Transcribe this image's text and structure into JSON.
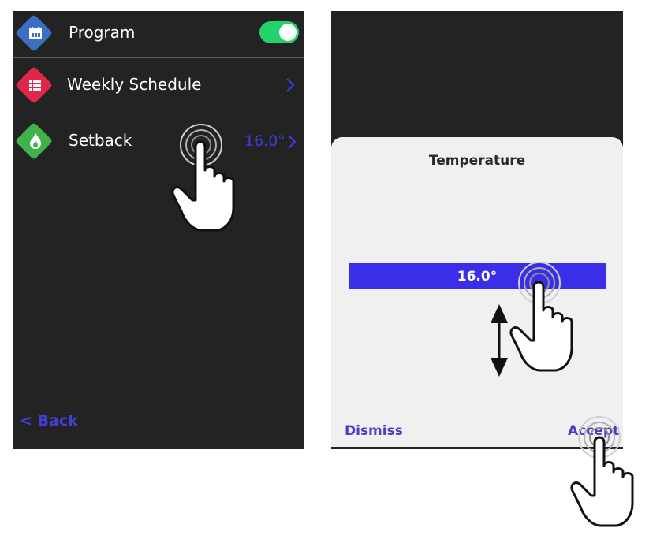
{
  "left_screen": {
    "rows": [
      {
        "label": "Program",
        "icon": "calendar-icon",
        "color": "#3a6fc2",
        "toggle": "on"
      },
      {
        "label": "Weekly Schedule",
        "icon": "list-icon",
        "color": "#e0264a"
      },
      {
        "label": "Setback",
        "icon": "flame-icon",
        "color": "#3fb24a",
        "value": "16.0°"
      }
    ],
    "back_label": "< Back",
    "toggle_color": "#22d36b",
    "accent_color": "#3c3cde"
  },
  "right_screen": {
    "dialog_title": "Temperature",
    "value": "16.0°",
    "dismiss_label": "Dismiss",
    "accept_label": "Accept",
    "bar_color": "#3a2ee8"
  }
}
